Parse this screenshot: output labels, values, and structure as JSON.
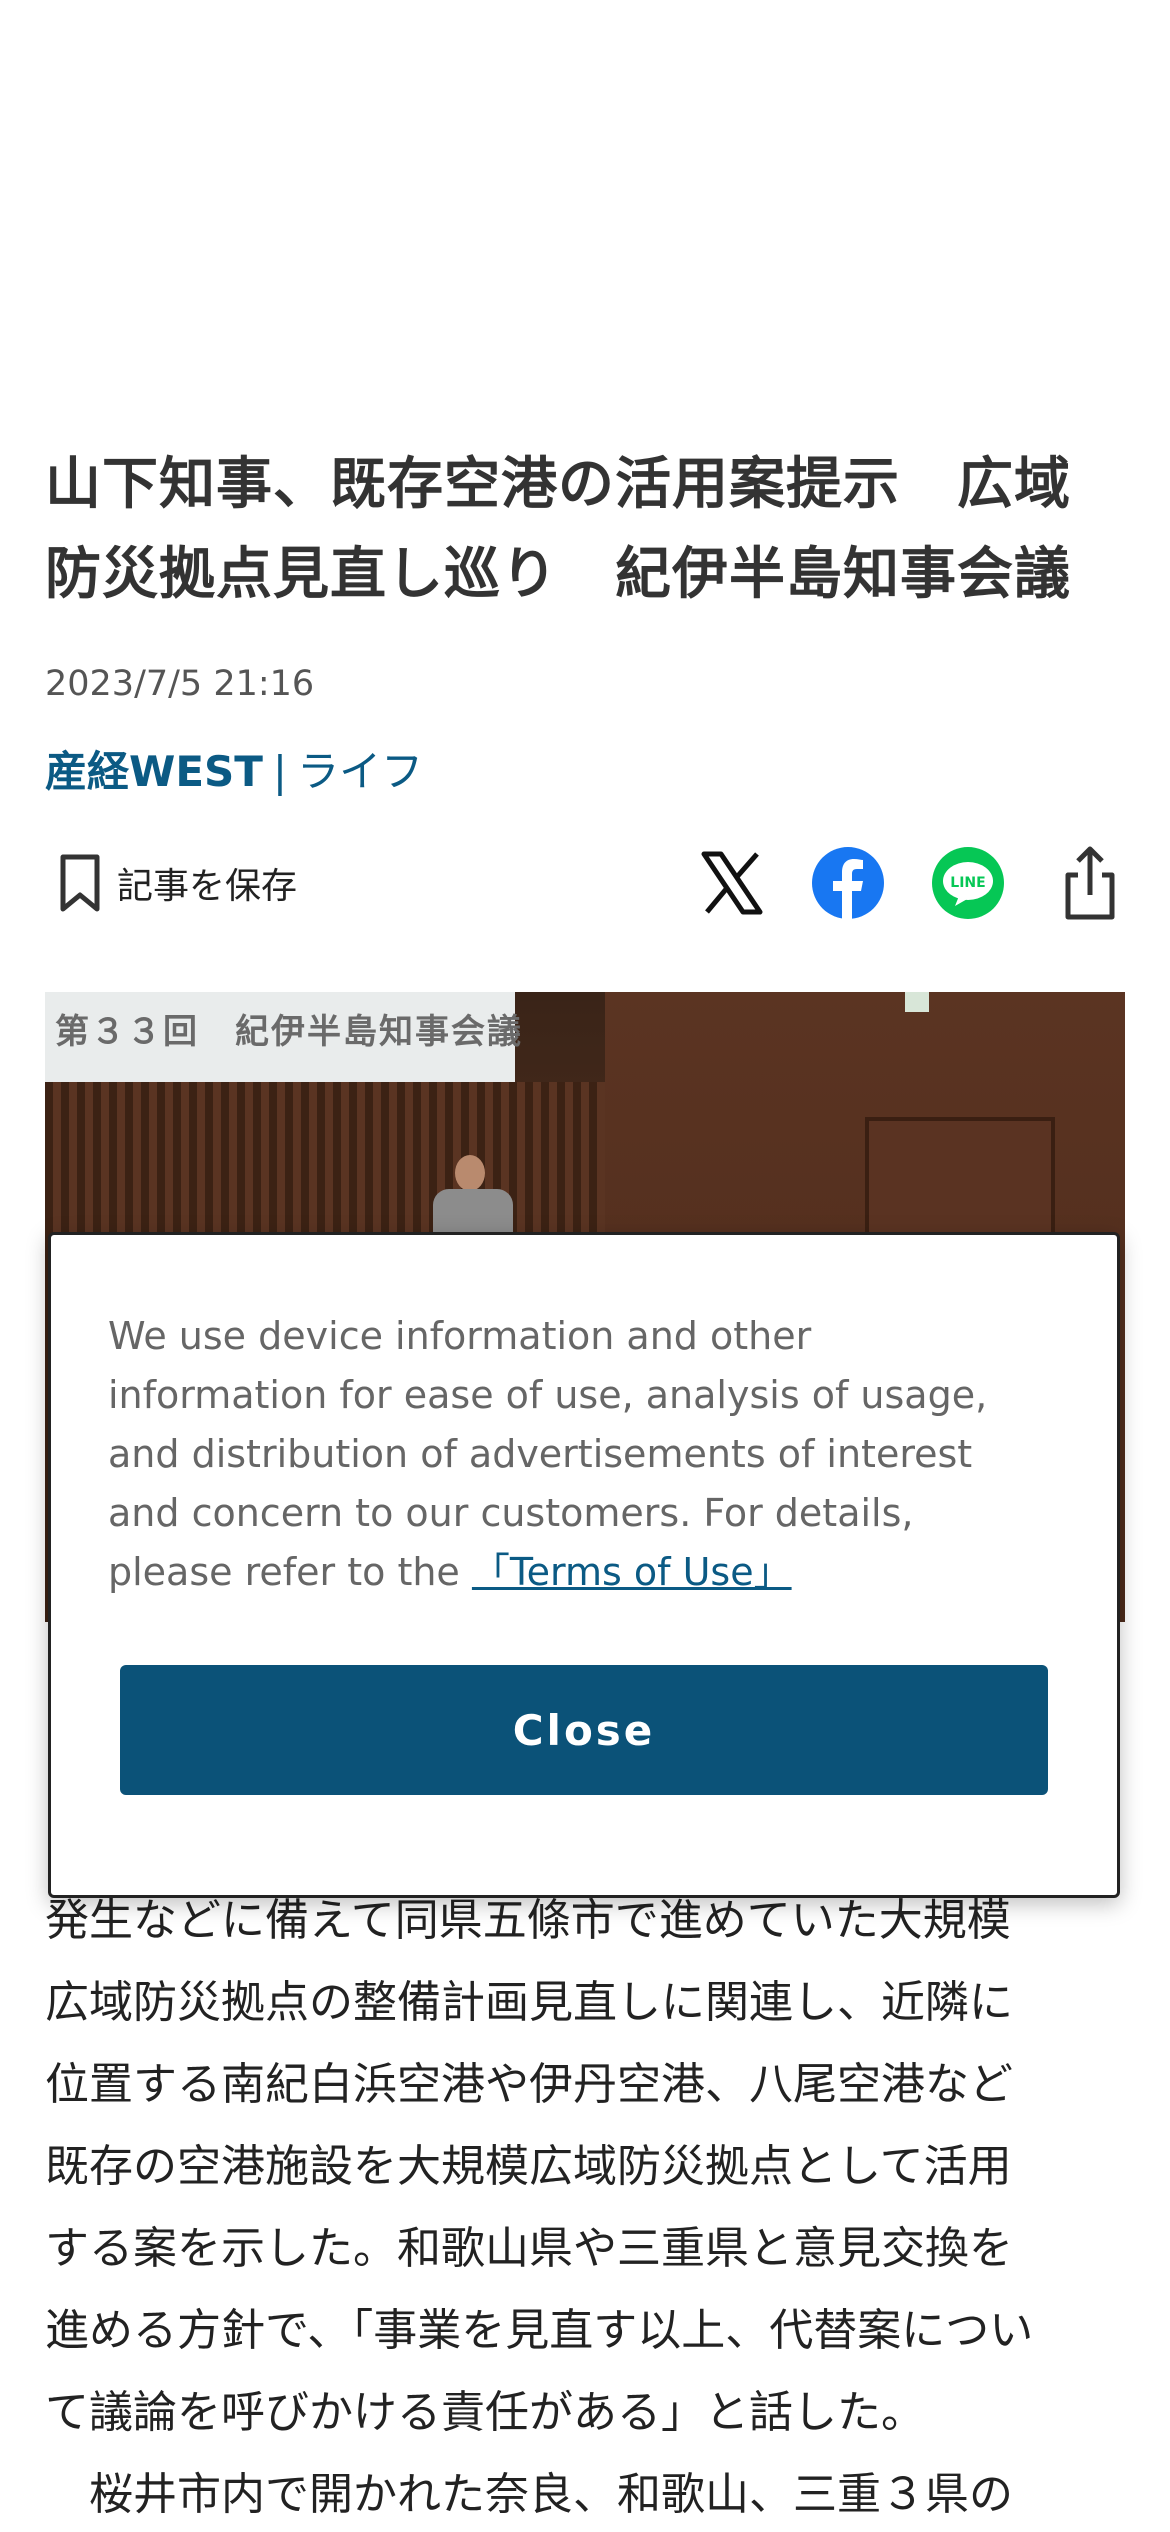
{
  "article": {
    "headline_line1": "山下知事、既存空港の活用案提示　広域",
    "headline_line2": "防災拠点見直し巡り　紀伊半島知事会議",
    "timestamp": "2023/7/5 21:16",
    "source": "産経WEST",
    "separator": "|",
    "category": "ライフ"
  },
  "actions": {
    "save_label": "記事を保存",
    "share_icons": [
      "x-icon",
      "facebook-icon",
      "line-icon",
      "share-icon"
    ],
    "line_icon_text": "LINE"
  },
  "photo": {
    "screen_text": "第３３回　紀伊半島知事会議"
  },
  "body": {
    "lines": [
      "発生などに備えて同県五條市で進めていた大規模",
      "広域防災拠点の整備計画見直しに関連し、近隣に",
      "位置する南紀白浜空港や伊丹空港、八尾空港など",
      "既存の空港施設を大規模広域防災拠点として活用",
      "する案を示した。和歌山県や三重県と意見交換を",
      "進める方針で、「事業を見直す以上、代替案につい",
      "て議論を呼びかける責任がある」と話した。",
      "　桜井市内で開かれた奈良、和歌山、三重３県の"
    ]
  },
  "consent": {
    "line1": "We use device information and other",
    "line2": "information for ease of use, analysis of usage,",
    "line3": "and distribution of advertisements of interest",
    "line4": "and concern to our customers. For details,",
    "line5_prefix": "please refer to the ",
    "terms_link": "「Terms of Use」",
    "close_label": "Close"
  },
  "colors": {
    "brand_blue": "#0b5a84",
    "close_button": "#0b5278",
    "facebook": "#1877f2",
    "line": "#06c755"
  }
}
